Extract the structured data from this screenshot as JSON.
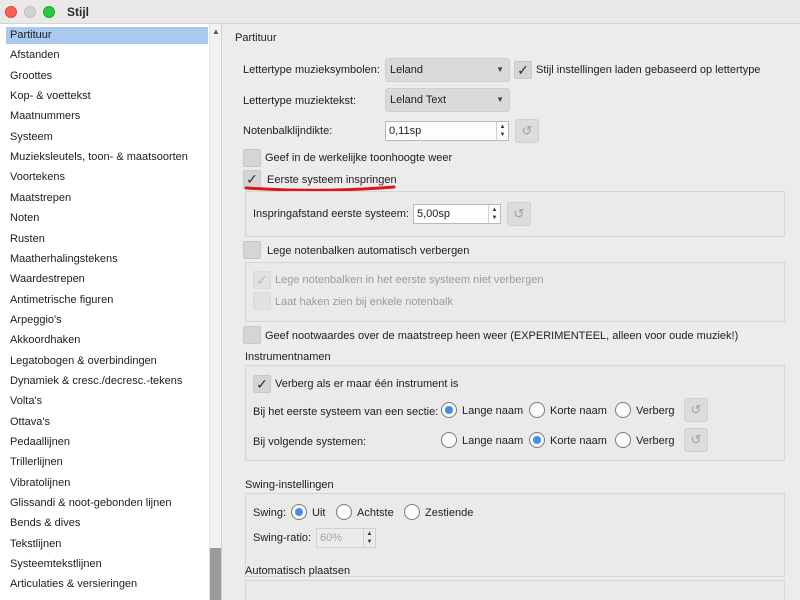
{
  "window": {
    "title": "Stijl"
  },
  "sidebar": {
    "items": [
      "Partituur",
      "Afstanden",
      "Groottes",
      "Kop- & voettekst",
      "Maatnummers",
      "Systeem",
      "Muzieksleutels, toon- & maatsoorten",
      "Voortekens",
      "Maatstrepen",
      "Noten",
      "Rusten",
      "Maatherhalingstekens",
      "Waardestrepen",
      "Antimetrische figuren",
      "Arpeggio's",
      "Akkoordhaken",
      "Legatobogen & overbindingen",
      "Dynamiek & cresc./decresc.-tekens",
      "Volta's",
      "Ottava's",
      "Pedaallijnen",
      "Trillerlijnen",
      "Vibratolijnen",
      "Glissandi & noot-gebonden lijnen",
      "Bends & dives",
      "Tekstlijnen",
      "Systeemtekstlijnen",
      "Articulaties & versieringen"
    ],
    "selected_index": 0
  },
  "partituur": {
    "section_title": "Partituur",
    "music_font_label": "Lettertype muzieksymbolen:",
    "music_font_value": "Leland",
    "load_style_label": "Stijl instellingen laden gebaseerd op lettertype",
    "load_style_checked": true,
    "text_font_label": "Lettertype muziektekst:",
    "text_font_value": "Leland Text",
    "staff_line_label": "Notenbalklijndikte:",
    "staff_line_value": "0,11sp",
    "concert_pitch_label": "Geef in de werkelijke toonhoogte weer",
    "concert_pitch_checked": false,
    "indent_label": "Eerste systeem inspringen",
    "indent_checked": true,
    "indent_distance_label": "Inspringafstand eerste systeem:",
    "indent_distance_value": "5,00sp",
    "hide_empty_label": "Lege notenbalken automatisch verbergen",
    "hide_empty_checked": false,
    "dont_hide_first_label": "Lege notenbalken in het eerste systeem niet verbergen",
    "dont_hide_first_checked": true,
    "show_brackets_label": "Laat haken zien bij enkele notenbalk",
    "show_brackets_checked": false,
    "barline_values_label": "Geef nootwaardes over de maatstreep heen weer (EXPERIMENTEEL, alleen voor oude muziek!)",
    "barline_values_checked": false
  },
  "instrumentnamen": {
    "section_title": "Instrumentnamen",
    "hide_single_label": "Verberg als er maar één instrument is",
    "hide_single_checked": true,
    "first_system_label": "Bij het eerste systeem van een sectie:",
    "following_systems_label": "Bij volgende systemen:",
    "option_long": "Lange naam",
    "option_short": "Korte naam",
    "option_hide": "Verberg",
    "first_system_selected": "Lange naam",
    "following_systems_selected": "Korte naam"
  },
  "swing": {
    "section_title": "Swing-instellingen",
    "swing_label": "Swing:",
    "option_off": "Uit",
    "option_eighth": "Achtste",
    "option_sixteenth": "Zestiende",
    "selected": "Uit",
    "ratio_label": "Swing-ratio:",
    "ratio_value": "60%"
  },
  "autoplace": {
    "section_title": "Automatisch plaatsen"
  },
  "icons": {
    "reset": "reset-icon",
    "checkmark": "checkmark-icon",
    "dropdown": "chevron-down-icon"
  },
  "colors": {
    "selection": "#a9c9ef",
    "radio_accent": "#3f8fe8",
    "annotation_red": "#e0141b"
  }
}
